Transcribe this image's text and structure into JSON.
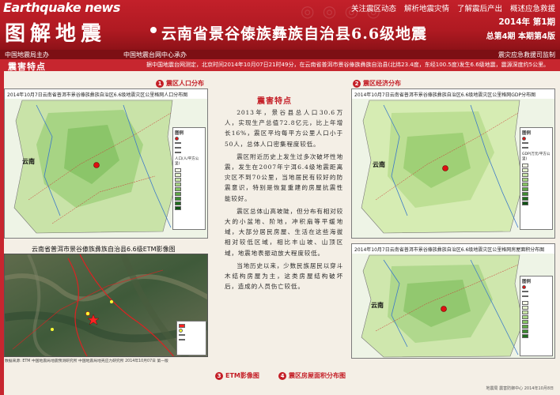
{
  "header": {
    "brand": "Earthquake news",
    "nav": [
      "关注震区动态",
      "解析地震灾情",
      "了解震后产出",
      "概述应急救援"
    ],
    "main_title": "图解地震",
    "sub_title": "云南省景谷傣族彝族自治县6.6级地震",
    "issue_line1": "2014年 第1期",
    "issue_line2": "总第4期 本期第4版"
  },
  "ribbon": {
    "left": "中国地震局主办",
    "middle": "中国地震台网中心承办",
    "right": "震灾应急救援司监制"
  },
  "section": {
    "label": "震害特点",
    "announcement": "据中国地震台网测定，北京时间2014年10月07日21时49分，在云南省普洱市景谷傣族彝族自治县(北纬23.4度，东经100.5度)发生6.6级地震，震源深度约5公里。"
  },
  "panels": {
    "p1": {
      "num": "1",
      "label": "震区人口分布",
      "caption": "2014年10月7日云南省普洱市景谷傣族彝族自治区6.6级地震灾区公里格网人口分布图",
      "province": "云南",
      "legend_title": "图例",
      "legend_unit": "人口(人/平方公里)"
    },
    "p2": {
      "num": "2",
      "label": "震区经济分布",
      "caption": "2014年10月7日云南省普洱市景谷傣族彝族自治区6.6级地震灾区公里格网GDP分布图",
      "province": "云南",
      "legend_title": "图例",
      "legend_unit": "GDP(万元/平方公里)"
    },
    "p3": {
      "num": "3",
      "label": "ETM影像图",
      "caption": "云南省普洱市景谷傣族彝族自治县6.6级ETM影像图",
      "footnote": "数据来源: ETM    中国地震局地震预测研究所    中国地震局地壳应力研究所    2014年10月07日 第一版"
    },
    "p4": {
      "num": "4",
      "label": "震区房屋面积分布图",
      "caption": "2014年10月7日云南省普洱市景谷傣族彝族自治区6.6级地震灾区公里格网房屋面积分布图",
      "province": "云南",
      "legend_title": "图例"
    }
  },
  "article": {
    "title": "震害特点",
    "paragraphs": [
      "2013年，景谷县总人口30.6万人，实现生产总值72.8亿元，比上年增长16%，震区平均每平方公里人口小于50人，总体人口密集程度较低。",
      "震区附近历史上发生过多次破坏性地震，发生在2007年宁洱6.4级地震距离灾区不到70公里，当地居民有较好的防震意识，特别是恢复重建的房屋抗震性能较好。",
      "震区总体山高坡陡，但分布有相对较大的小盆地、阶地，冲积扇等平缓地域，大部分居民房屋、生活在这些海拔相对较低区域，相比丰山坡、山顶区域，地震地表振动放大程度较低。",
      "当地历史以来，少数民族居民以穿斗木结构房屋为主，这类房屋结构破坏后，造成的人员伤亡较低。"
    ]
  },
  "footer": "地震局 震害防御中心 2014年10月8日"
}
